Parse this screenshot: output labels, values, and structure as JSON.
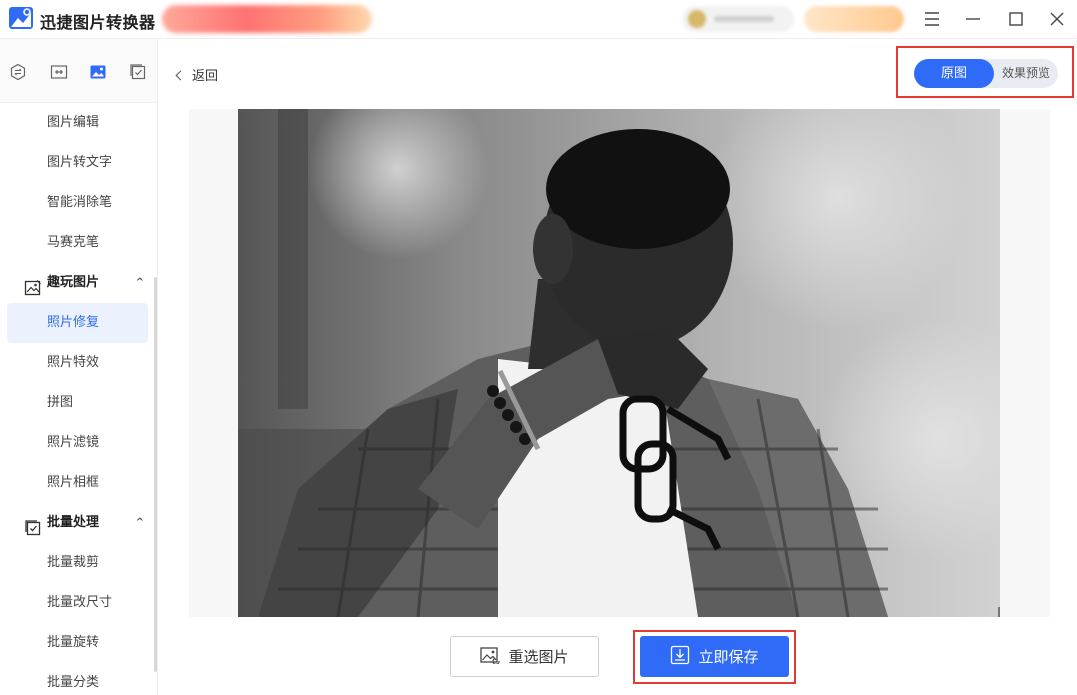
{
  "app": {
    "title": "迅捷图片转换器",
    "accent": "#2f6bf6"
  },
  "titlebar": {
    "icons": [
      "menu-icon",
      "minimize-icon",
      "maximize-icon",
      "close-icon"
    ]
  },
  "sidebar": {
    "top_icons": [
      "convert-icon",
      "compress-icon",
      "image-icon",
      "batch-check-icon"
    ],
    "items": [
      {
        "label": "图片编辑"
      },
      {
        "label": "图片转文字"
      },
      {
        "label": "智能消除笔"
      },
      {
        "label": "马赛克笔"
      }
    ],
    "group_fun": {
      "label": "趣玩图片",
      "items": [
        {
          "label": "照片修复",
          "active": true
        },
        {
          "label": "照片特效"
        },
        {
          "label": "拼图"
        },
        {
          "label": "照片滤镜"
        },
        {
          "label": "照片相框"
        }
      ]
    },
    "group_batch": {
      "label": "批量处理",
      "items": [
        {
          "label": "批量裁剪"
        },
        {
          "label": "批量改尺寸"
        },
        {
          "label": "批量旋转"
        },
        {
          "label": "批量分类"
        }
      ]
    }
  },
  "main": {
    "back_label": "返回",
    "toggle": {
      "original_label": "原图",
      "preview_label": "效果预览",
      "selected": "原图"
    }
  },
  "actions": {
    "reselect_label": "重选图片",
    "save_label": "立即保存"
  }
}
